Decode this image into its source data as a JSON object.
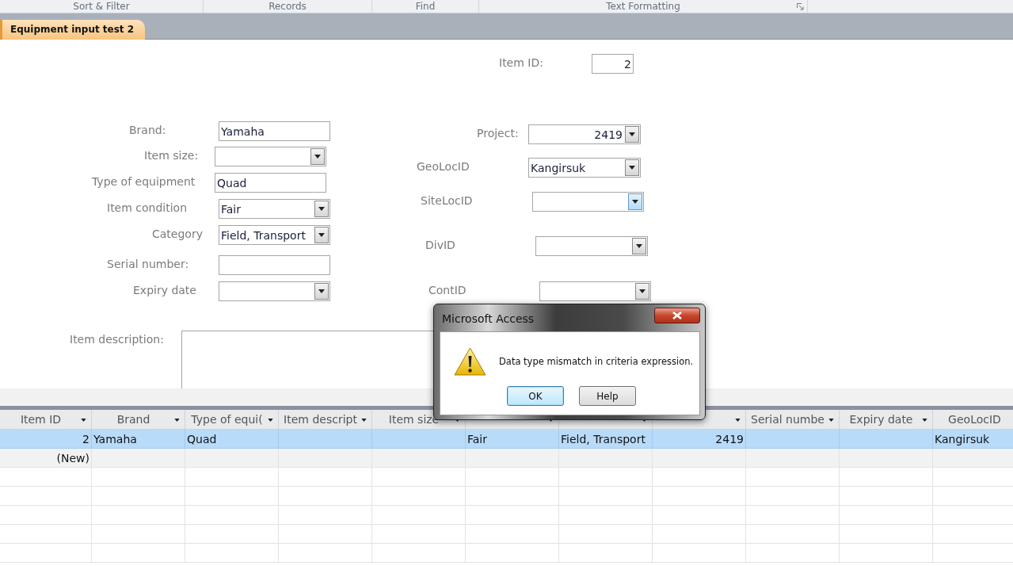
{
  "ribbon_groups": [
    {
      "label": "Sort & Filter",
      "launcher": false
    },
    {
      "label": "Records",
      "launcher": false
    },
    {
      "label": "Find",
      "launcher": false
    },
    {
      "label": "Text Formatting",
      "launcher": true
    }
  ],
  "document_tab": {
    "label": "Equipment input test 2",
    "selected": true
  },
  "form": {
    "fields": [
      {
        "label": "Item ID:",
        "value": "2",
        "kind": "text",
        "numeric": true
      },
      {
        "label": "Brand:",
        "value": "Yamaha",
        "kind": "text",
        "numeric": false
      },
      {
        "label": "Item size:",
        "kind": "combo",
        "button_highlighted": false
      },
      {
        "label": "Type of equipment",
        "value": "Quad",
        "kind": "text",
        "numeric": false
      },
      {
        "label": "Item condition",
        "value": "Fair",
        "kind": "combo",
        "numeric": false,
        "button_highlighted": false
      },
      {
        "label": "Category",
        "value": "Field, Transport",
        "kind": "combo",
        "numeric": false,
        "button_highlighted": false
      },
      {
        "label": "Serial number:",
        "kind": "text"
      },
      {
        "label": "Expiry date",
        "kind": "combo",
        "button_highlighted": false
      },
      {
        "label": "Item description:",
        "kind": "memo"
      },
      {
        "label": "Project:",
        "value": "2419",
        "kind": "combo",
        "numeric": true,
        "button_highlighted": false
      },
      {
        "label": "GeoLocID",
        "value": "Kangirsuk",
        "kind": "combo",
        "numeric": false,
        "button_highlighted": false
      },
      {
        "label": "SiteLocID",
        "kind": "combo",
        "button_highlighted": true
      },
      {
        "label": "DivID",
        "kind": "combo",
        "button_highlighted": false
      },
      {
        "label": "ContID",
        "kind": "combo",
        "button_highlighted": false
      }
    ]
  },
  "datasheet": {
    "columns": [
      {
        "label": "Item ID"
      },
      {
        "label": "Brand"
      },
      {
        "label": "Type of equi("
      },
      {
        "label": "Item descript"
      },
      {
        "label": "Item size"
      },
      {},
      {},
      {},
      {
        "label": "Serial numbe"
      },
      {
        "label": "Expiry date"
      },
      {
        "label": "GeoLocID"
      }
    ],
    "rows": [
      {
        "selected": true,
        "cells": [
          {
            "text": "2",
            "numeric": true
          },
          {
            "text": "Yamaha",
            "numeric": false
          },
          {
            "text": "Quad",
            "numeric": false
          },
          null,
          null,
          {
            "text": "Fair",
            "numeric": false
          },
          {
            "text": "Field, Transport",
            "numeric": false
          },
          {
            "text": "2419",
            "numeric": true
          },
          null,
          null,
          {
            "text": "Kangirsuk",
            "numeric": false
          }
        ]
      },
      {
        "selected": false,
        "cells": [
          {
            "text": "(New)",
            "numeric": true
          }
        ]
      }
    ]
  },
  "dialog": {
    "title": "Microsoft Access",
    "message": "Data type mismatch in criteria expression.",
    "buttons": [
      {
        "label": "OK",
        "default": true
      },
      {
        "label": "Help",
        "default": false
      }
    ]
  }
}
